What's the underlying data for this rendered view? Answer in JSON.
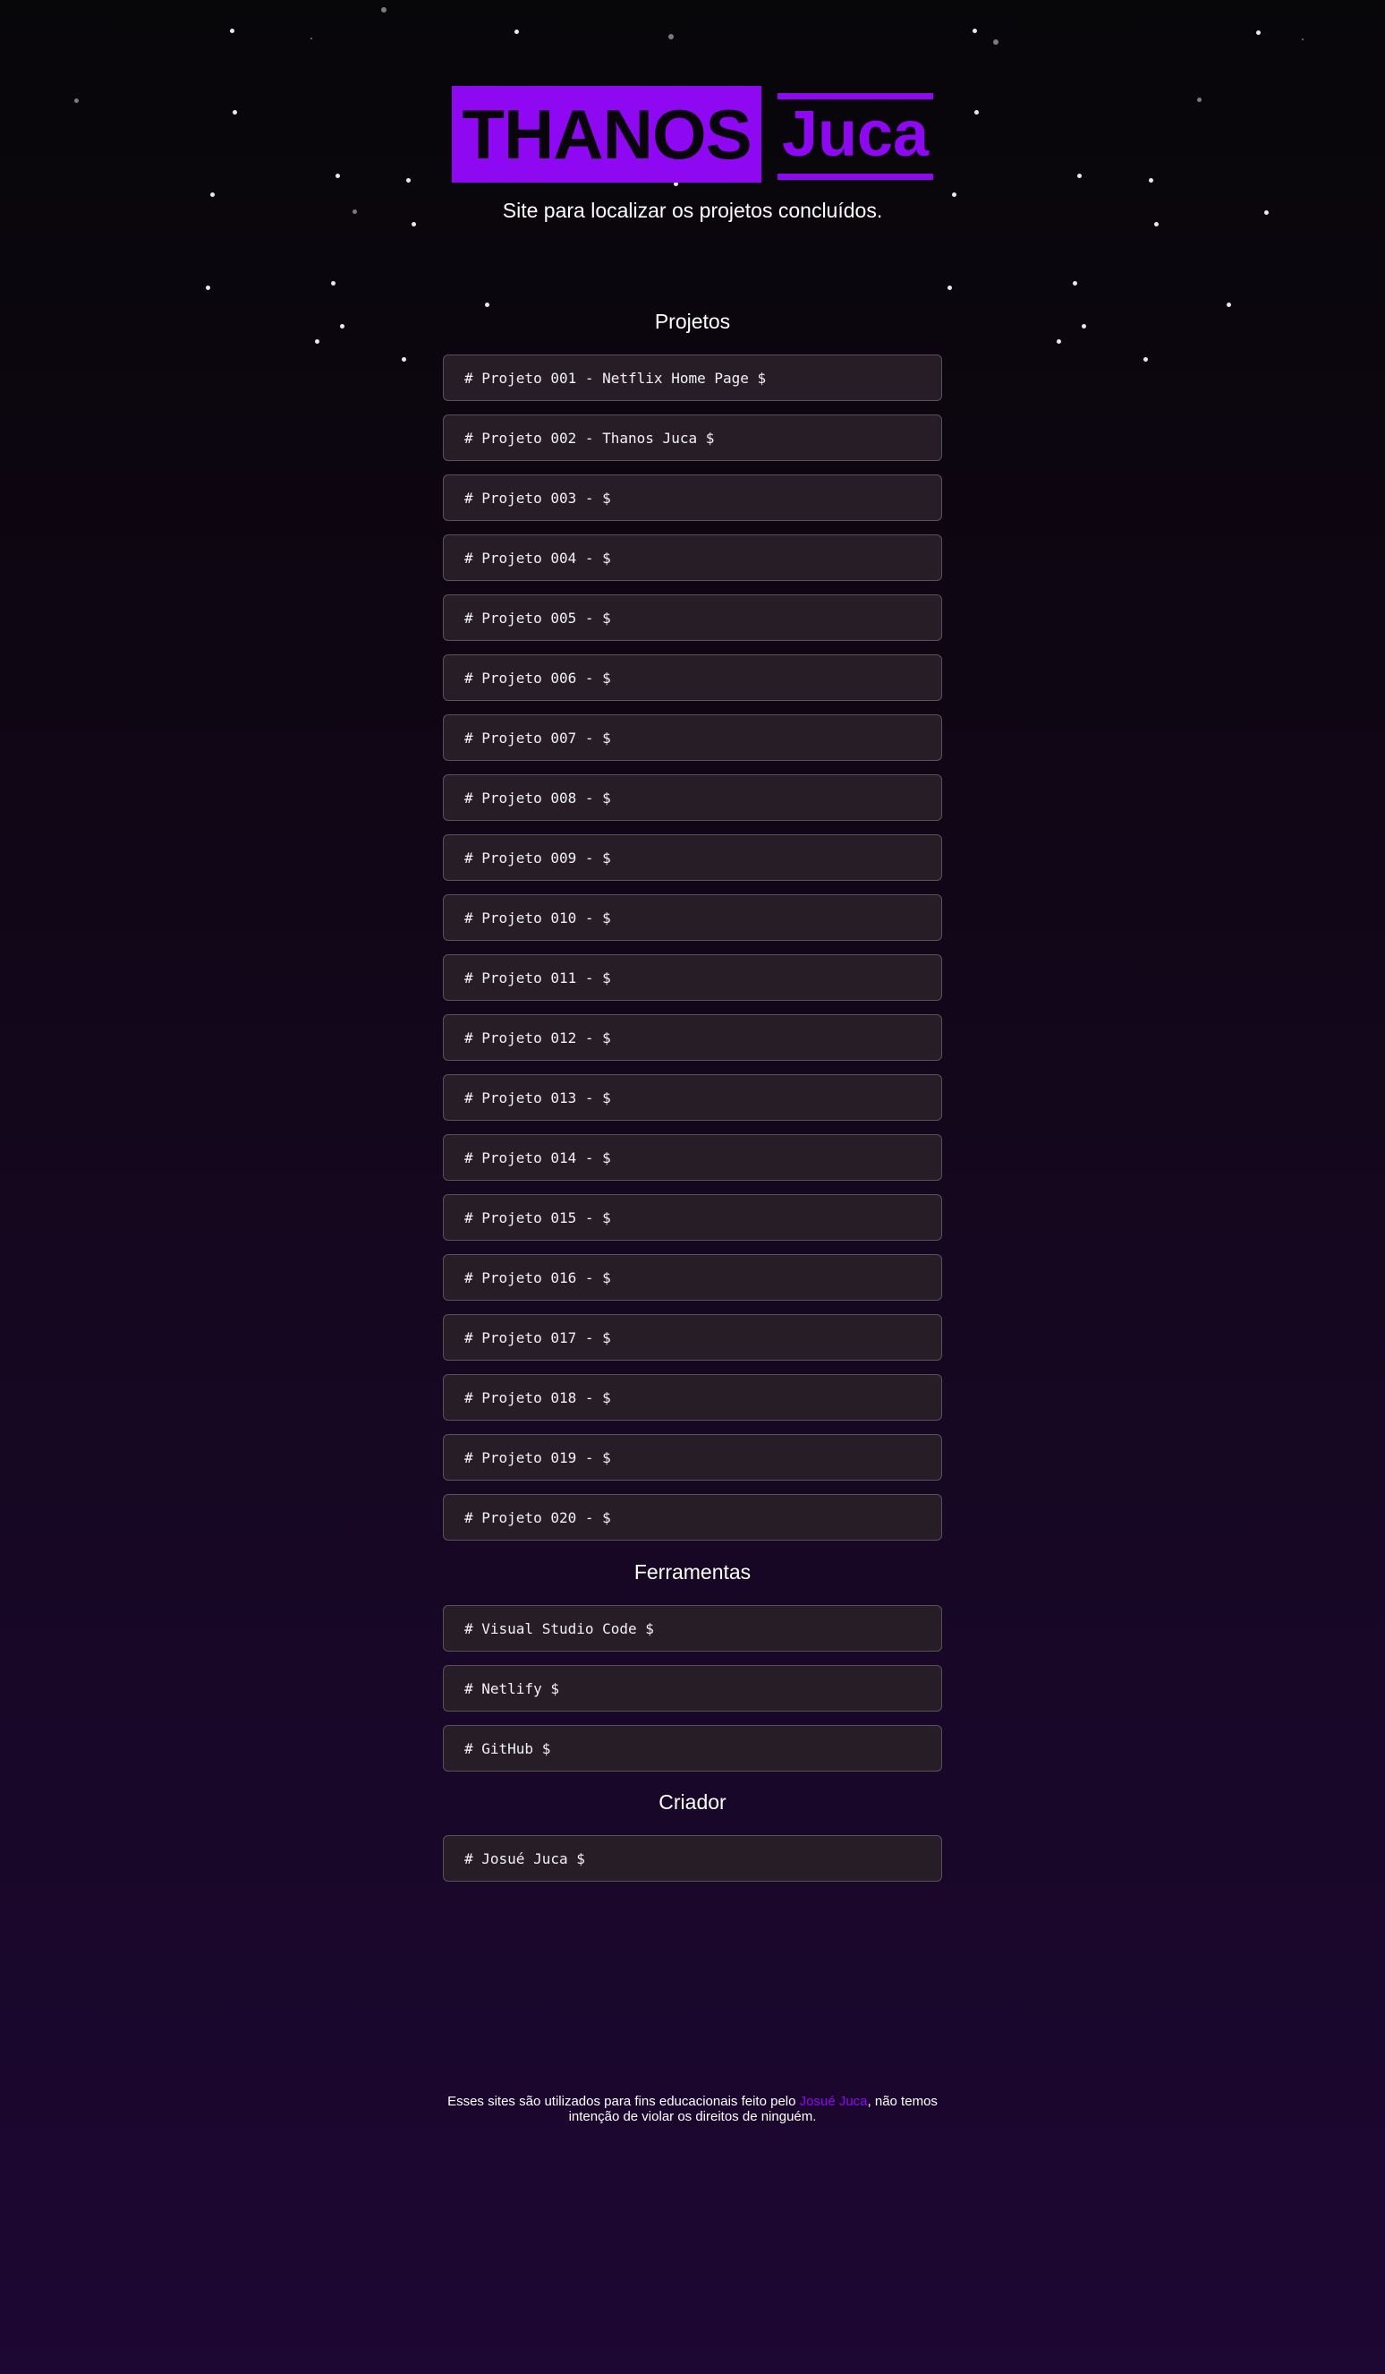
{
  "header": {
    "logo_primary": "THANOS",
    "logo_secondary": "Juca",
    "subtitle": "Site para localizar os projetos concluídos."
  },
  "sections": {
    "projects": {
      "title": "Projetos",
      "items": [
        "# Projeto 001 - Netflix Home Page $",
        "# Projeto 002 - Thanos Juca $",
        "# Projeto 003 - $",
        "# Projeto 004 - $",
        "# Projeto 005 - $",
        "# Projeto 006 - $",
        "# Projeto 007 - $",
        "# Projeto 008 - $",
        "# Projeto 009 - $",
        "# Projeto 010 - $",
        "# Projeto 011 - $",
        "# Projeto 012 - $",
        "# Projeto 013 - $",
        "# Projeto 014 - $",
        "# Projeto 015 - $",
        "# Projeto 016 - $",
        "# Projeto 017 - $",
        "# Projeto 018 - $",
        "# Projeto 019 - $",
        "# Projeto 020 - $"
      ]
    },
    "tools": {
      "title": "Ferramentas",
      "items": [
        "# Visual Studio Code $",
        "# Netlify $",
        "# GitHub $"
      ]
    },
    "creator": {
      "title": "Criador",
      "items": [
        "# Josué Juca $"
      ]
    }
  },
  "footer": {
    "text_before": "Esses sites são utilizados para fins educacionais feito pelo ",
    "author_link": "Josué Juca",
    "text_after_line1": ", não temos",
    "text_line2": "intenção de violar os direitos de ninguém."
  },
  "colors": {
    "accent": "#8e08f2",
    "card_background": "#261d26",
    "card_border": "#5a505c",
    "background_top": "#070609",
    "background_bottom": "#1d0733"
  }
}
